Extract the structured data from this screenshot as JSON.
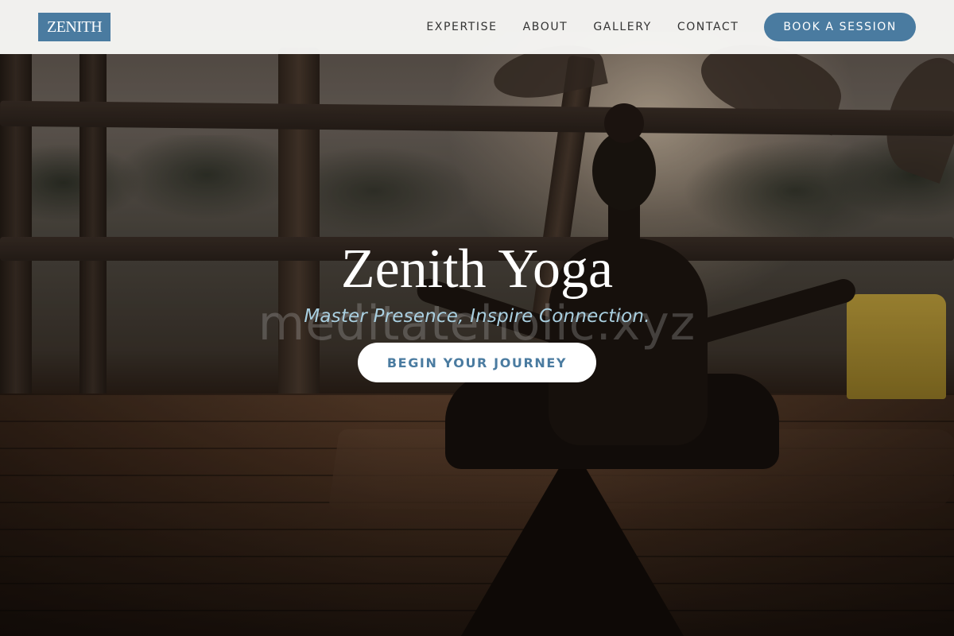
{
  "brand": {
    "logo_text": "ZENITH",
    "accent_color": "#4a7ba0"
  },
  "nav": {
    "links": [
      {
        "label": "EXPERTISE"
      },
      {
        "label": "ABOUT"
      },
      {
        "label": "GALLERY"
      },
      {
        "label": "CONTACT"
      }
    ],
    "cta_label": "BOOK A SESSION"
  },
  "hero": {
    "title": "Zenith Yoga",
    "subtitle": "Master Presence, Inspire Connection.",
    "cta_label": "BEGIN YOUR JOURNEY",
    "watermark": "meditateholic.xyz",
    "background_image": "person-meditating-on-wooden-deck-at-sunrise"
  }
}
